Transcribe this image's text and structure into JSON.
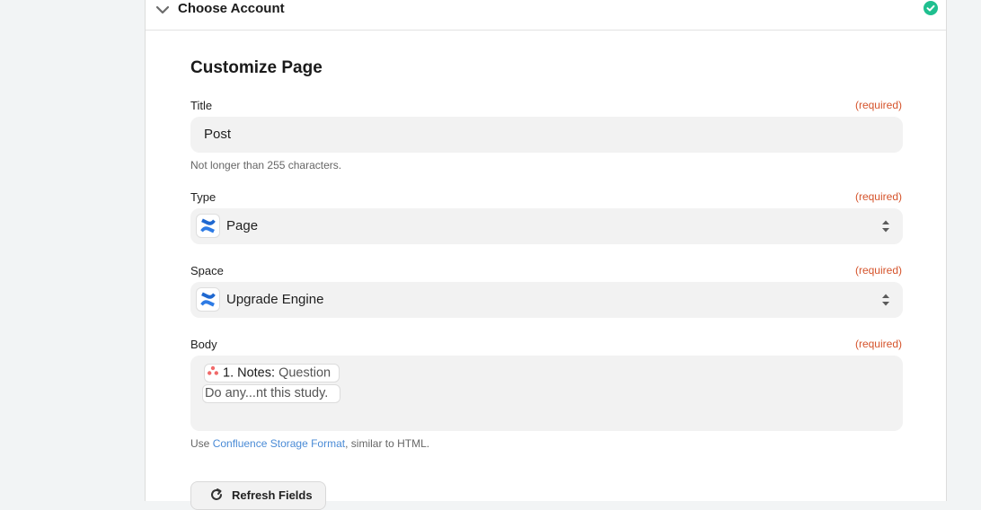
{
  "header": {
    "title": "Choose Account",
    "status": "complete"
  },
  "section": {
    "title": "Customize Page"
  },
  "fields": {
    "title": {
      "label": "Title",
      "required": "(required)",
      "value": "Post",
      "help": "Not longer than 255 characters."
    },
    "type": {
      "label": "Type",
      "required": "(required)",
      "value": "Page",
      "icon": "confluence-icon"
    },
    "space": {
      "label": "Space",
      "required": "(required)",
      "value": "Upgrade Engine",
      "icon": "confluence-icon"
    },
    "body": {
      "label": "Body",
      "required": "(required)",
      "token_step": "1. Notes:",
      "token_field": "Question",
      "token_value": "Do any...nt this study.",
      "token_icon": "asana-icon",
      "help_prefix": "Use ",
      "help_link": "Confluence Storage Format",
      "help_suffix": ", similar to HTML."
    }
  },
  "refresh_button": {
    "label": "Refresh Fields"
  },
  "colors": {
    "required": "#d5532b",
    "link": "#4a8bd6",
    "check": "#1fbf8f",
    "confluence": "#2d7be5"
  }
}
